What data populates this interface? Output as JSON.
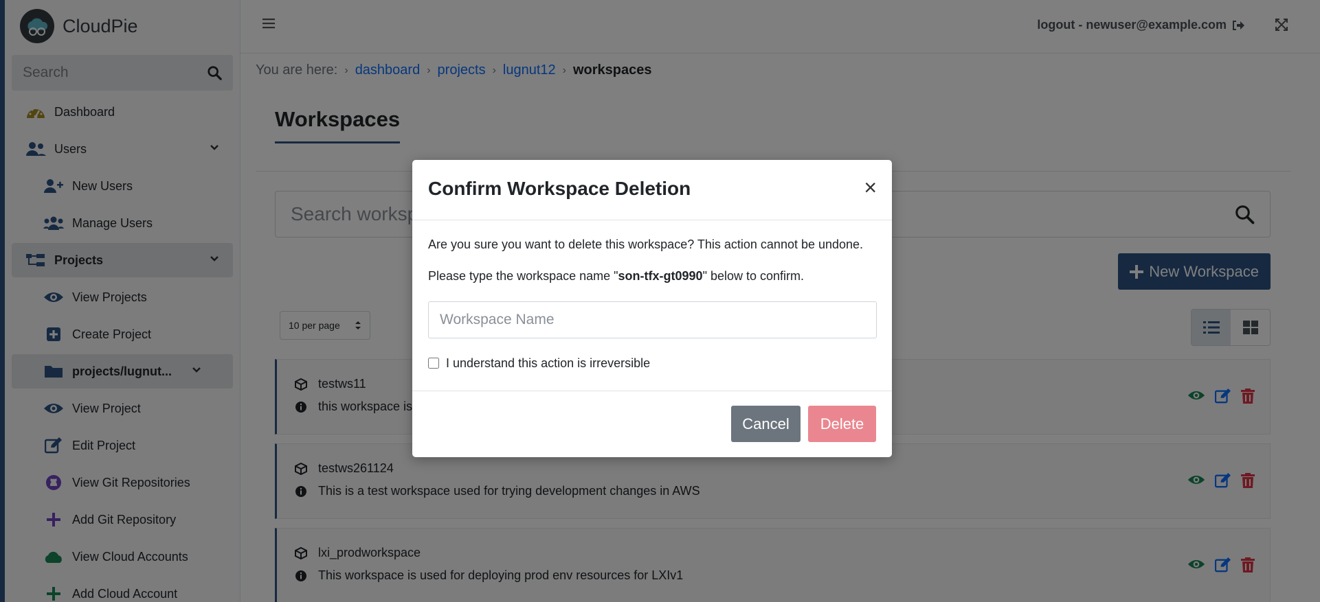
{
  "brand": {
    "name": "CloudPie"
  },
  "sidebar": {
    "search_placeholder": "Search",
    "items": [
      {
        "label": "Dashboard",
        "icon": "gauge-icon"
      },
      {
        "label": "Users",
        "icon": "users-icon"
      },
      {
        "label": "New Users",
        "icon": "user-plus-icon"
      },
      {
        "label": "Manage Users",
        "icon": "users-cog-icon"
      },
      {
        "label": "Projects",
        "icon": "sitemap-icon"
      },
      {
        "label": "View Projects",
        "icon": "eye-icon"
      },
      {
        "label": "Create Project",
        "icon": "plus-square-icon"
      },
      {
        "label": "projects/lugnut...",
        "icon": "folder-icon"
      },
      {
        "label": "View Project",
        "icon": "eye-icon"
      },
      {
        "label": "Edit Project",
        "icon": "edit-icon"
      },
      {
        "label": "View Git Repositories",
        "icon": "github-icon"
      },
      {
        "label": "Add Git Repository",
        "icon": "plus-icon"
      },
      {
        "label": "View Cloud Accounts",
        "icon": "cloud-icon"
      },
      {
        "label": "Add Cloud Account",
        "icon": "plus-icon"
      }
    ]
  },
  "header": {
    "logout_label": "logout - newuser@example.com"
  },
  "breadcrumb": {
    "prefix": "You are here:",
    "items": [
      "dashboard",
      "projects",
      "lugnut12"
    ],
    "current": "workspaces"
  },
  "main": {
    "title": "Workspaces",
    "search_placeholder": "Search workspaces",
    "new_button": "New Workspace",
    "per_page": "10 per page",
    "workspaces": [
      {
        "name": "testws11",
        "description": "this workspace is"
      },
      {
        "name": "testws261124",
        "description": "This is a test workspace used for trying development changes in AWS"
      },
      {
        "name": "lxi_prodworkspace",
        "description": "This workspace is used for deploying prod env resources for LXIv1"
      }
    ]
  },
  "modal": {
    "title": "Confirm Workspace Deletion",
    "close": "×",
    "warning": "Are you sure you want to delete this workspace? This action cannot be undone.",
    "instruction_prefix": "Please type the workspace name \"",
    "workspace_name": "son-tfx-gt0990",
    "instruction_suffix": "\" below to confirm.",
    "input_placeholder": "Workspace Name",
    "checkbox_label": "I understand this action is irreversible",
    "cancel_label": "Cancel",
    "delete_label": "Delete"
  },
  "colors": {
    "primary": "#2c5282",
    "danger_disabled": "#ea868f",
    "secondary": "#6c757d",
    "view_green": "#198754",
    "edit_blue": "#0d6efd",
    "delete_red": "#dc3545"
  }
}
